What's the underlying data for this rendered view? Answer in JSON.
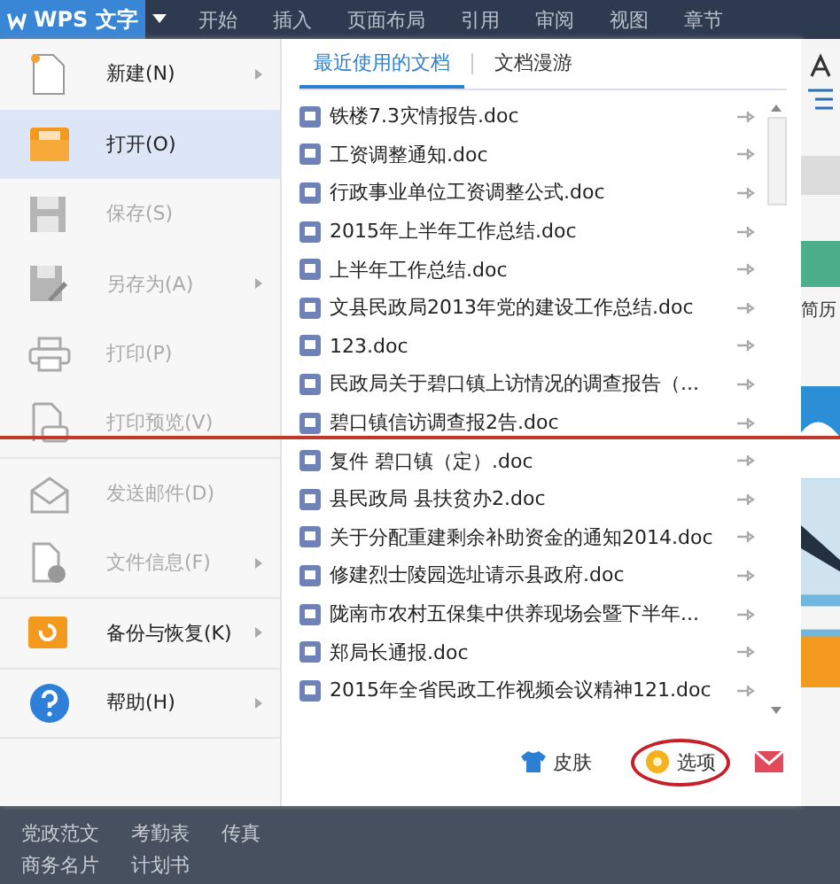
{
  "app_button": {
    "label": "WPS 文字"
  },
  "ribbon_tabs": [
    "开始",
    "插入",
    "页面布局",
    "引用",
    "审阅",
    "视图",
    "章节"
  ],
  "menu": [
    {
      "kind": "new",
      "label": "新建(N)",
      "disabled": false,
      "selected": false,
      "has_submenu": true,
      "divider_after": false
    },
    {
      "kind": "open",
      "label": "打开(O)",
      "disabled": false,
      "selected": true,
      "has_submenu": false,
      "divider_after": false
    },
    {
      "kind": "save",
      "label": "保存(S)",
      "disabled": true,
      "selected": false,
      "has_submenu": false,
      "divider_after": false
    },
    {
      "kind": "save_as",
      "label": "另存为(A)",
      "disabled": true,
      "selected": false,
      "has_submenu": true,
      "divider_after": false
    },
    {
      "kind": "print",
      "label": "打印(P)",
      "disabled": true,
      "selected": false,
      "has_submenu": false,
      "divider_after": false
    },
    {
      "kind": "preview",
      "label": "打印预览(V)",
      "disabled": true,
      "selected": false,
      "has_submenu": false,
      "divider_after": true
    },
    {
      "kind": "mail",
      "label": "发送邮件(D)",
      "disabled": true,
      "selected": false,
      "has_submenu": false,
      "divider_after": false
    },
    {
      "kind": "info",
      "label": "文件信息(F)",
      "disabled": true,
      "selected": false,
      "has_submenu": true,
      "divider_after": true
    },
    {
      "kind": "backup",
      "label": "备份与恢复(K)",
      "disabled": false,
      "selected": false,
      "has_submenu": true,
      "divider_after": true
    },
    {
      "kind": "help",
      "label": "帮助(H)",
      "disabled": false,
      "selected": false,
      "has_submenu": true,
      "divider_after": true
    }
  ],
  "doc_tabs": [
    {
      "label": "最近使用的文档",
      "selected": true
    },
    {
      "label": "文档漫游",
      "selected": false
    }
  ],
  "recent_docs": [
    "铁楼7.3灾情报告.doc",
    "工资调整通知.doc",
    "行政事业单位工资调整公式.doc",
    "2015年上半年工作总结.doc",
    "上半年工作总结.doc",
    "文县民政局2013年党的建设工作总结.doc",
    "123.doc",
    "民政局关于碧口镇上访情况的调查报告（...",
    "碧口镇信访调查报2告.doc",
    "复件 碧口镇（定）.doc",
    "县民政局  县扶贫办2.doc",
    "关于分配重建剩余补助资金的通知2014.doc",
    "修建烈士陵园选址请示县政府.doc",
    "陇南市农村五保集中供养现场会暨下半年...",
    "郑局长通报.doc",
    "2015年全省民政工作视频会议精神121.doc"
  ],
  "footer": [
    {
      "kind": "skin",
      "label": "皮肤",
      "circled": false
    },
    {
      "kind": "options",
      "label": "选项",
      "circled": true
    },
    {
      "kind": "mail"
    }
  ],
  "side_text": "简历",
  "bottom_links": [
    [
      "党政范文",
      "考勤表",
      "传真"
    ],
    [
      "商务名片",
      "计划书"
    ]
  ],
  "annotation_line": true
}
